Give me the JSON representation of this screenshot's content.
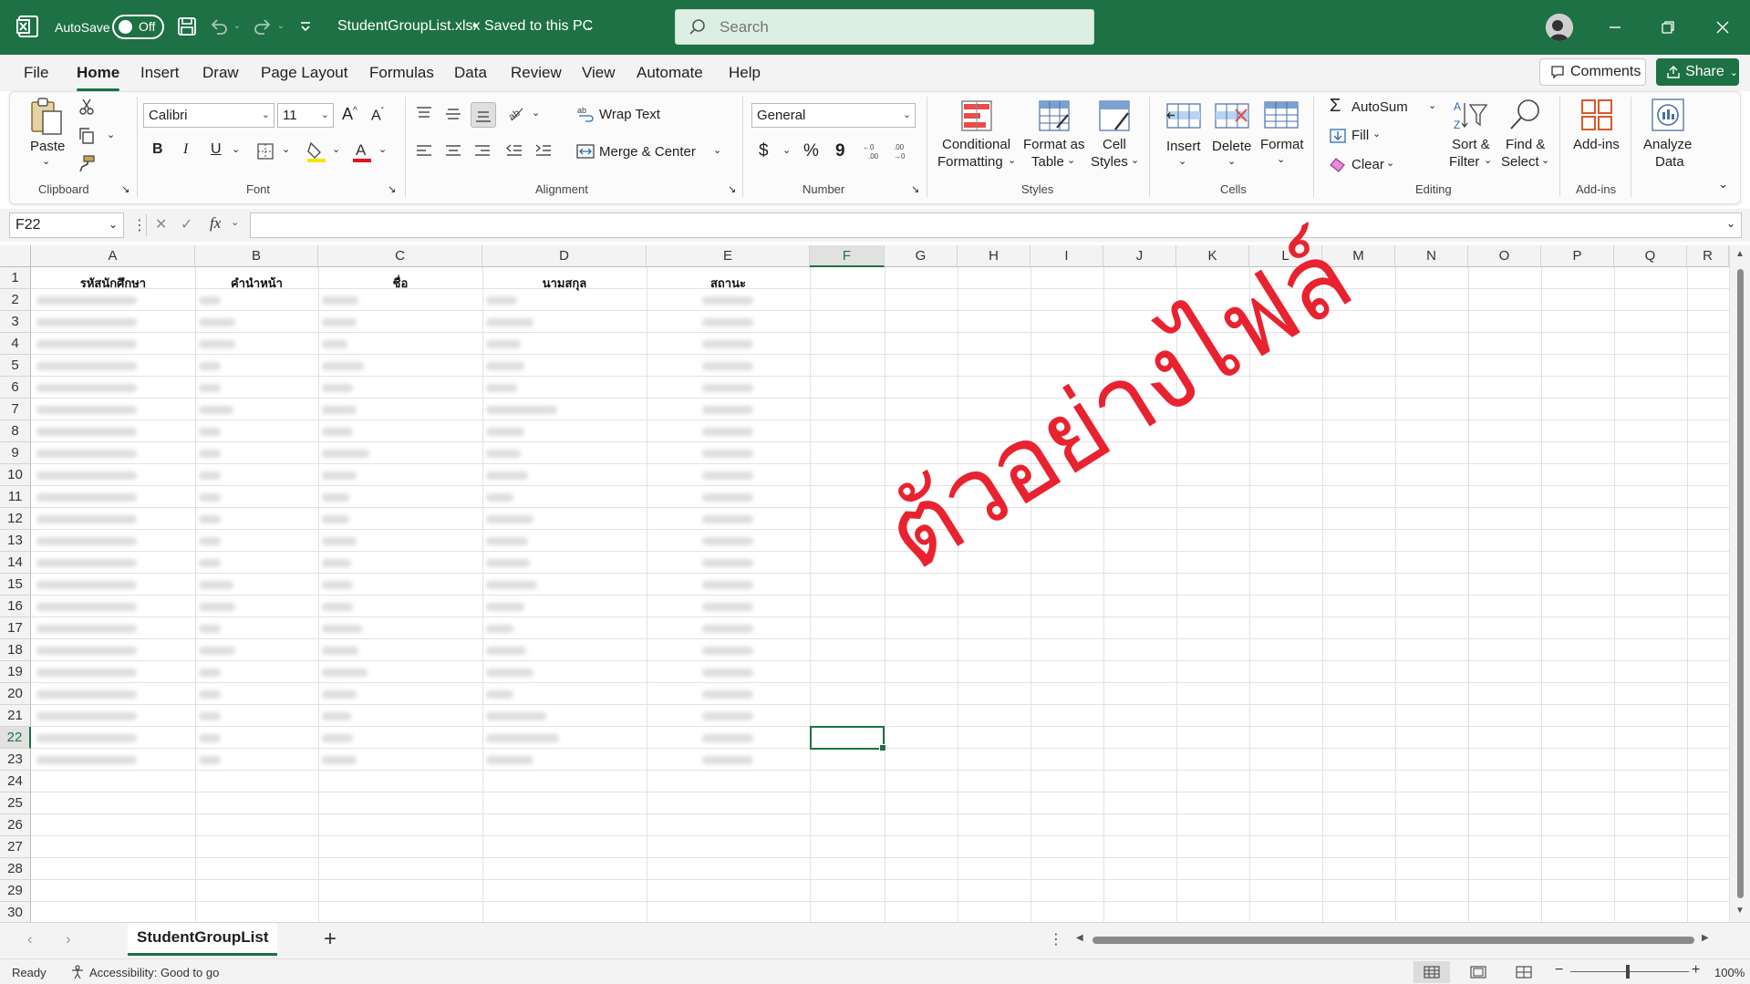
{
  "titlebar": {
    "autosave_label": "AutoSave",
    "autosave_state": "Off",
    "filename": "StudentGroupList.xlsx",
    "save_state": "Saved to this PC",
    "search_placeholder": "Search"
  },
  "tabs": [
    "File",
    "Home",
    "Insert",
    "Draw",
    "Page Layout",
    "Formulas",
    "Data",
    "Review",
    "View",
    "Automate",
    "Help"
  ],
  "active_tab": "Home",
  "buttons": {
    "comments": "Comments",
    "share": "Share"
  },
  "ribbon": {
    "clipboard": {
      "paste": "Paste",
      "label": "Clipboard"
    },
    "font": {
      "name": "Calibri",
      "size": "11",
      "label": "Font",
      "bold": "B",
      "italic": "I",
      "underline": "U"
    },
    "alignment": {
      "wrap_text": "Wrap Text",
      "merge_center": "Merge & Center",
      "label": "Alignment"
    },
    "number": {
      "format": "General",
      "label": "Number",
      "currency": "$",
      "percent": "%",
      "comma": "9"
    },
    "styles": {
      "conditional_1": "Conditional",
      "conditional_2": "Formatting",
      "format_table_1": "Format as",
      "format_table_2": "Table",
      "cell_styles_1": "Cell",
      "cell_styles_2": "Styles",
      "label": "Styles"
    },
    "cells": {
      "insert": "Insert",
      "delete": "Delete",
      "format": "Format",
      "label": "Cells"
    },
    "editing": {
      "autosum": "AutoSum",
      "fill": "Fill",
      "clear": "Clear",
      "sort_1": "Sort &",
      "sort_2": "Filter",
      "find_1": "Find &",
      "find_2": "Select",
      "label": "Editing"
    },
    "addins": {
      "addins": "Add-ins",
      "label": "Add-ins"
    },
    "analyze": {
      "line1": "Analyze",
      "line2": "Data"
    }
  },
  "formula_bar": {
    "name_box": "F22",
    "fx": "fx",
    "formula": ""
  },
  "grid": {
    "columns": [
      "A",
      "B",
      "C",
      "D",
      "E",
      "F",
      "G",
      "H",
      "I",
      "J",
      "K",
      "L",
      "M",
      "N",
      "O",
      "P",
      "Q",
      "R"
    ],
    "selected_column": "F",
    "rows": [
      "1",
      "2",
      "3",
      "4",
      "5",
      "6",
      "7",
      "8",
      "9",
      "10",
      "11",
      "12",
      "13",
      "14",
      "15",
      "16",
      "17",
      "18",
      "19",
      "20",
      "21",
      "22",
      "23",
      "24",
      "25",
      "26",
      "27",
      "28",
      "29",
      "30"
    ],
    "selected_row": "22",
    "headers": [
      "รหัสนักศึกษา",
      "คำนำหน้า",
      "ชื่อ",
      "นามสกุล",
      "สถานะ"
    ],
    "watermark": "ตัวอย่างไฟล์",
    "watermark_color": "#e8232f"
  },
  "sheets": {
    "active": "StudentGroupList",
    "add": "+"
  },
  "status": {
    "ready": "Ready",
    "accessibility": "Accessibility: Good to go",
    "zoom": "100%"
  },
  "colors": {
    "brand": "#1e7145",
    "watermark": "#e8232f"
  }
}
